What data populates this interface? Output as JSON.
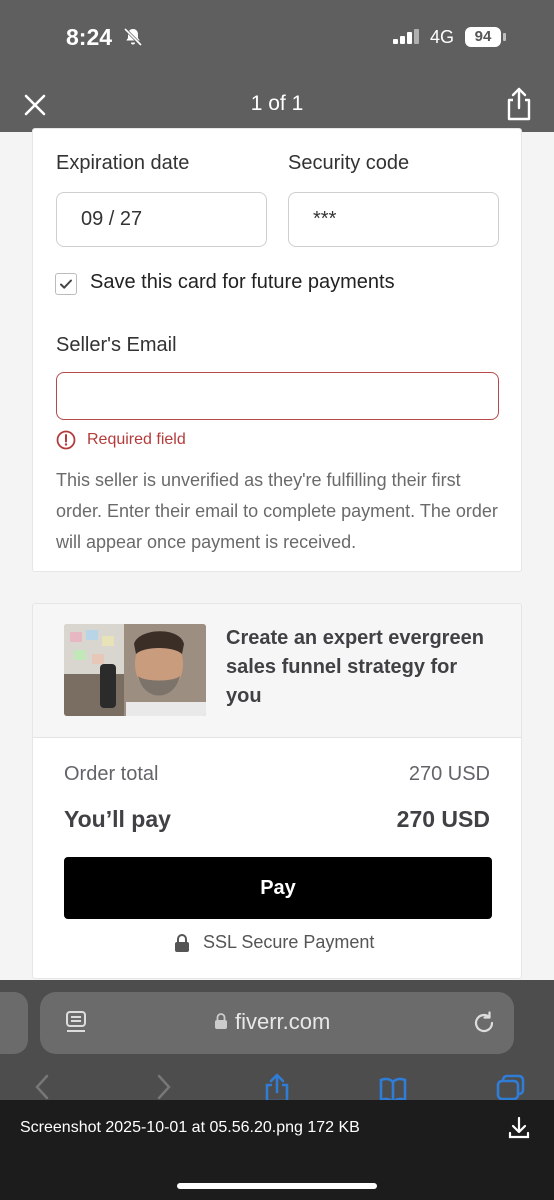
{
  "status_bar": {
    "time": "8:24",
    "network": "4G",
    "battery": "94"
  },
  "viewer": {
    "title": "1 of 1"
  },
  "payment_form": {
    "expiration_label": "Expiration date",
    "expiration_value": "09 / 27",
    "security_label": "Security code",
    "security_value": "***",
    "save_card_label": "Save this card for future payments",
    "save_card_checked": true,
    "seller_email_label": "Seller's Email",
    "seller_email_value": "",
    "error_text": "Required field",
    "note": "This seller is unverified as they're fulfilling their first order. Enter their email to complete payment. The order will appear once payment is received."
  },
  "order_summary": {
    "gig_title": "Create an expert evergreen sales funnel strategy for you",
    "order_total_label": "Order total",
    "order_total_value": "270 USD",
    "you_pay_label": "You’ll pay",
    "you_pay_value": "270 USD",
    "pay_button": "Pay",
    "secure_label": "SSL Secure Payment"
  },
  "browser": {
    "url": "fiverr.com"
  },
  "download": {
    "filename_text": "Screenshot 2025-10-01 at 05.56.20.png 172 KB"
  },
  "colors": {
    "error": "#b53b3b",
    "pay_button": "#000000",
    "top_bar": "#5f5f5f"
  }
}
